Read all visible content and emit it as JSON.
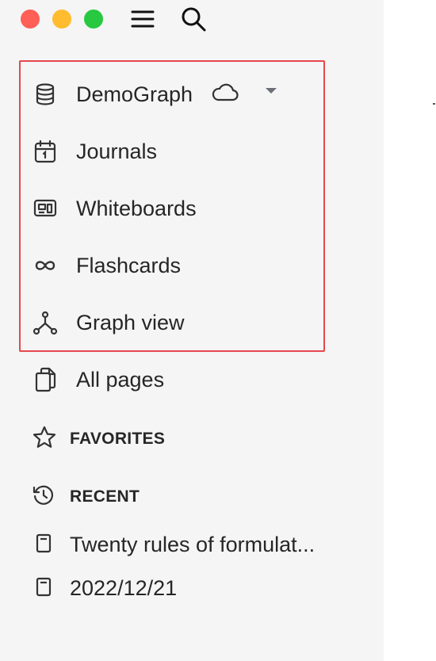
{
  "window": {
    "controls": [
      {
        "name": "close",
        "color": "#fe5f57"
      },
      {
        "name": "minimize",
        "color": "#febc2e"
      },
      {
        "name": "zoom",
        "color": "#28c840"
      }
    ],
    "toolbar_icons": [
      "menu-icon",
      "search-icon"
    ]
  },
  "graph": {
    "name": "DemoGraph",
    "icon": "database-icon",
    "sync_icon": "cloud-icon",
    "dropdown_icon": "caret-down-icon"
  },
  "nav": {
    "journals": {
      "label": "Journals",
      "icon": "calendar-icon"
    },
    "whiteboards": {
      "label": "Whiteboards",
      "icon": "whiteboard-icon"
    },
    "flashcards": {
      "label": "Flashcards",
      "icon": "infinity-icon"
    },
    "graph_view": {
      "label": "Graph view",
      "icon": "graph-icon"
    },
    "all_pages": {
      "label": "All pages",
      "icon": "files-icon"
    }
  },
  "sections": {
    "favorites": {
      "label": "FAVORITES",
      "icon": "star-icon"
    },
    "recent": {
      "label": "RECENT",
      "icon": "history-icon"
    }
  },
  "recent_items": [
    {
      "label": "Twenty rules of formulat...",
      "icon": "page-icon"
    },
    {
      "label": "2022/12/21",
      "icon": "page-icon"
    }
  ],
  "colors": {
    "sidebar_bg": "#f5f5f5",
    "highlight_border": "#e5484d",
    "text": "#262626"
  }
}
